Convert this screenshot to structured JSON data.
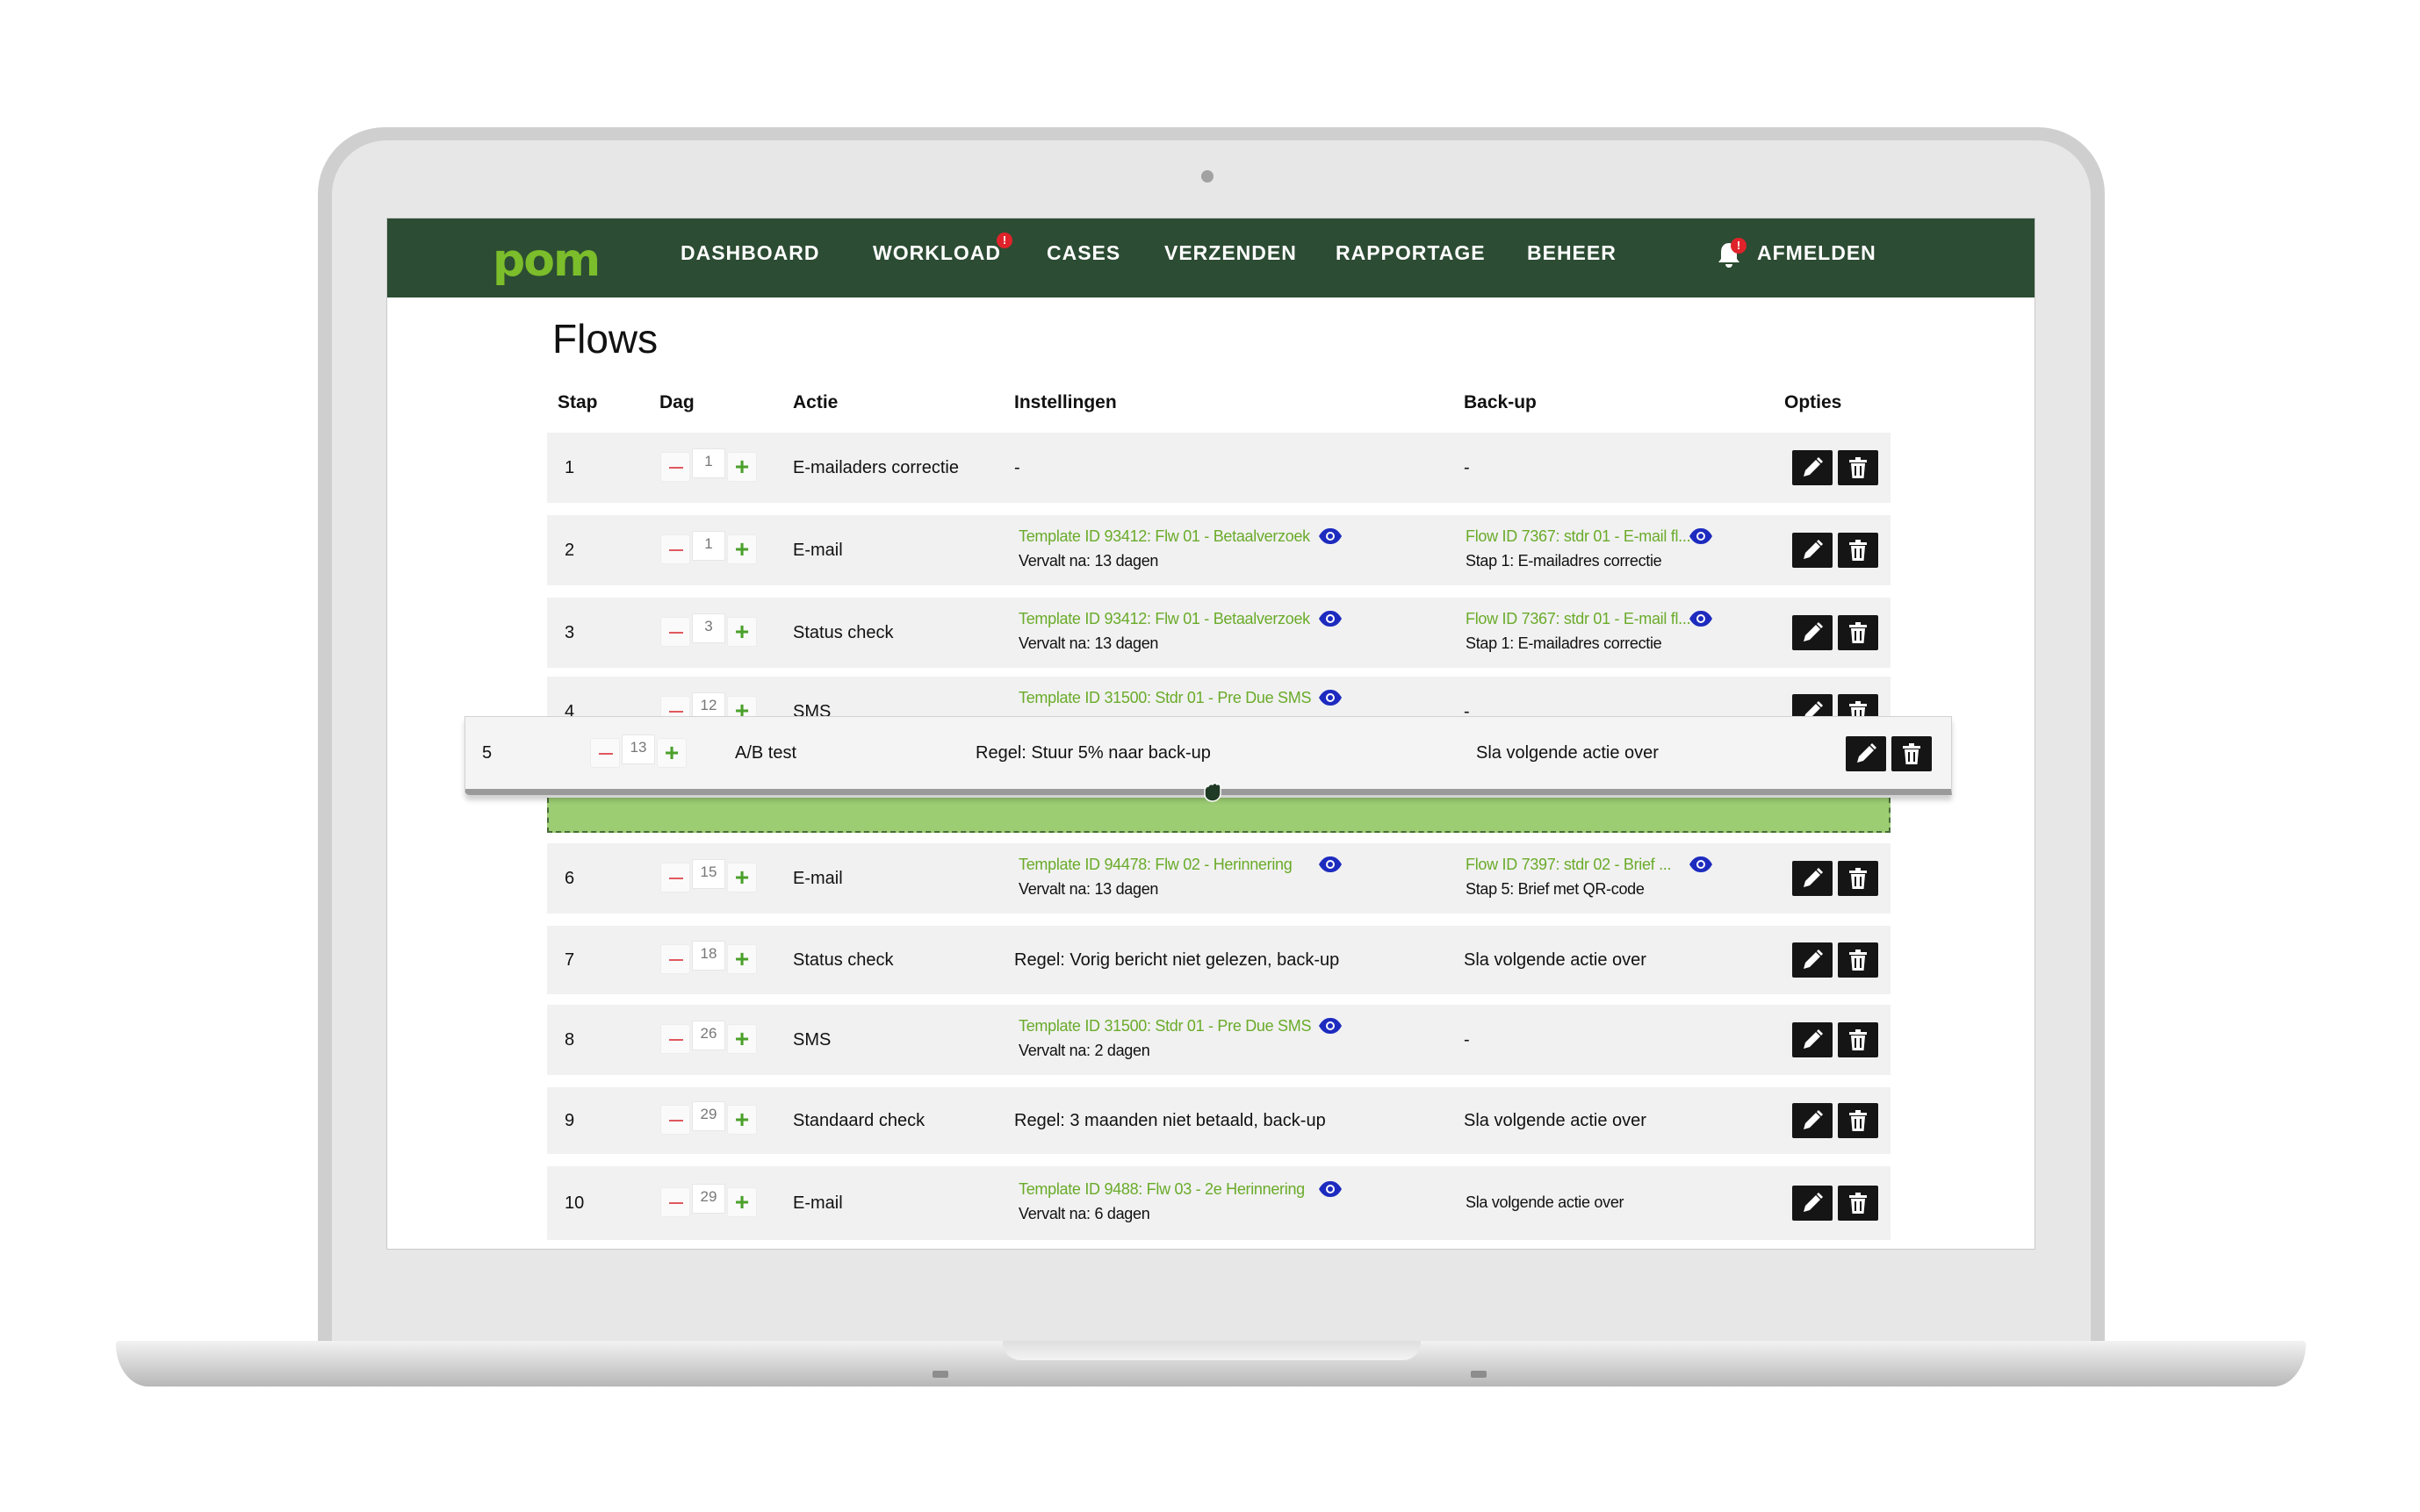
{
  "app": {
    "logo": "pom",
    "nav": [
      "DASHBOARD",
      "WORKLOAD",
      "CASES",
      "VERZENDEN",
      "RAPPORTAGE",
      "BEHEER"
    ],
    "workload_badge": "!",
    "bell_badge": "!",
    "logout": "AFMELDEN"
  },
  "page": {
    "title": "Flows"
  },
  "columns": [
    "Stap",
    "Dag",
    "Actie",
    "Instellingen",
    "Back-up",
    "Opties"
  ],
  "rows": [
    {
      "stap": "1",
      "dag": "1",
      "actie": "E-mailaders correctie",
      "inst_text": "-",
      "backup_text": "-"
    },
    {
      "stap": "2",
      "dag": "1",
      "actie": "E-mail",
      "inst_link": "Template ID 93412: Flw 01 - Betaalverzoek",
      "inst_sub": "Vervalt na: 13 dagen",
      "backup_link": "Flow ID 7367: stdr 01 - E-mail fl...",
      "backup_sub": "Stap 1: E-mailadres correctie"
    },
    {
      "stap": "3",
      "dag": "3",
      "actie": "Status check",
      "inst_link": "Template ID 93412: Flw 01 - Betaalverzoek",
      "inst_sub": "Vervalt na: 13 dagen",
      "backup_link": "Flow ID 7367: stdr 01 - E-mail fl...",
      "backup_sub": "Stap 1: E-mailadres correctie"
    },
    {
      "stap": "4",
      "dag": "12",
      "actie": "SMS",
      "inst_link": "Template ID 31500: Stdr 01 - Pre Due SMS",
      "backup_text": "-"
    },
    {
      "stap": "5",
      "dag": "13",
      "actie": "A/B test",
      "inst_text": "Regel: Stuur 5% naar back-up",
      "backup_text": "Sla volgende actie over"
    },
    {
      "stap": "6",
      "dag": "15",
      "actie": "E-mail",
      "inst_link": "Template ID 94478: Flw 02 - Herinnering",
      "inst_sub": "Vervalt na: 13 dagen",
      "backup_link": "Flow ID 7397: stdr 02 - Brief ...",
      "backup_sub": "Stap 5: Brief met QR-code"
    },
    {
      "stap": "7",
      "dag": "18",
      "actie": "Status check",
      "inst_text": "Regel: Vorig bericht niet gelezen, back-up",
      "backup_text": "Sla volgende actie over"
    },
    {
      "stap": "8",
      "dag": "26",
      "actie": "SMS",
      "inst_link": "Template ID 31500: Stdr 01 - Pre Due SMS",
      "inst_sub": "Vervalt na: 2 dagen",
      "backup_text": "-"
    },
    {
      "stap": "9",
      "dag": "29",
      "actie": "Standaard check",
      "inst_text": "Regel: 3 maanden niet betaald, back-up",
      "backup_text": "Sla volgende actie over"
    },
    {
      "stap": "10",
      "dag": "29",
      "actie": "E-mail",
      "inst_link": "Template ID 9488: Flw 03 - 2e Herinnering",
      "inst_sub": "Vervalt na: 6 dagen",
      "backup_text": "Sla volgende actie over"
    }
  ],
  "colors": {
    "nav_bg": "#2c4c33",
    "logo": "#7bbd2a",
    "link": "#6aab2a",
    "eye": "#1d2bbf",
    "drop_zone": "#9ccd73",
    "row_bg": "#f1f1f1"
  },
  "icons": {
    "edit": "pencil-icon",
    "delete": "trash-icon",
    "preview": "eye-icon",
    "notifications": "bell-icon",
    "drag": "grab-hand-icon"
  }
}
